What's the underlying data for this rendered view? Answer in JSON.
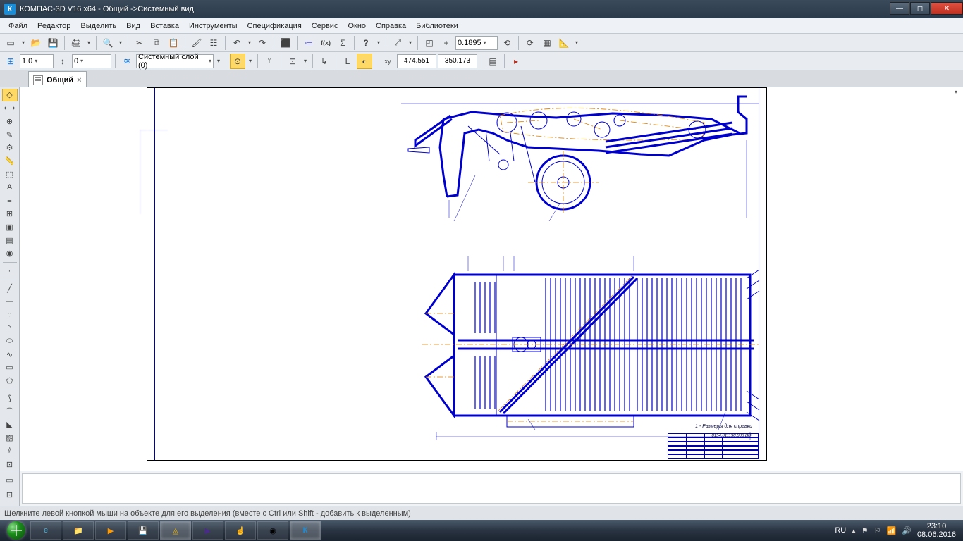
{
  "titlebar": {
    "app_icon_letter": "К",
    "title": "КОМПАС-3D V16  x64 - Общий ->Системный вид"
  },
  "menubar": {
    "items": [
      "Файл",
      "Редактор",
      "Выделить",
      "Вид",
      "Вставка",
      "Инструменты",
      "Спецификация",
      "Сервис",
      "Окно",
      "Справка",
      "Библиотеки"
    ]
  },
  "toolbar1": {
    "zoom_value": "0.1895"
  },
  "toolbar2": {
    "step_value": "1.0",
    "state_value": "0",
    "layer_value": "Системный слой (0)",
    "coord_x": "474.551",
    "coord_y": "350.173"
  },
  "doctabs": {
    "active": {
      "label": "Общий"
    }
  },
  "cad": {
    "title_block_code": "0154.011190.000 ВО",
    "note": "1 - Размеры для справки"
  },
  "statusbar": {
    "hint": "Щелкните левой кнопкой мыши на объекте для его выделения (вместе с Ctrl или Shift - добавить к выделенным)"
  },
  "tray": {
    "lang": "RU",
    "time": "23:10",
    "date": "08.06.2016"
  },
  "icons": {
    "minimize": "—",
    "maximize": "◻",
    "close": "✕",
    "new": "▭",
    "open": "📂",
    "save": "💾",
    "print": "🖨",
    "preview": "🔍",
    "cut": "✂",
    "copy": "⧉",
    "paste": "📋",
    "brush": "🖌",
    "props": "☷",
    "undo": "↶",
    "redo": "↷",
    "stop": "⬛",
    "var": "≔",
    "fx": "f(x)",
    "sigma": "Σ",
    "help": "?",
    "zoomall": "⤢",
    "zoomwin": "◰",
    "zoomin": "+",
    "prevview": "⟲",
    "refresh": "⟳",
    "frames": "▦",
    "measure": "📐",
    "snap": "⊞",
    "arrow": "↕",
    "ortho": "⊥",
    "grid": "⊡",
    "local": "↳",
    "L": "L",
    "angle": "∡",
    "xy": "xy",
    "doc": "▤",
    "tag": "▸",
    "ie": "e",
    "chrome": "◉",
    "kompas": "К"
  }
}
